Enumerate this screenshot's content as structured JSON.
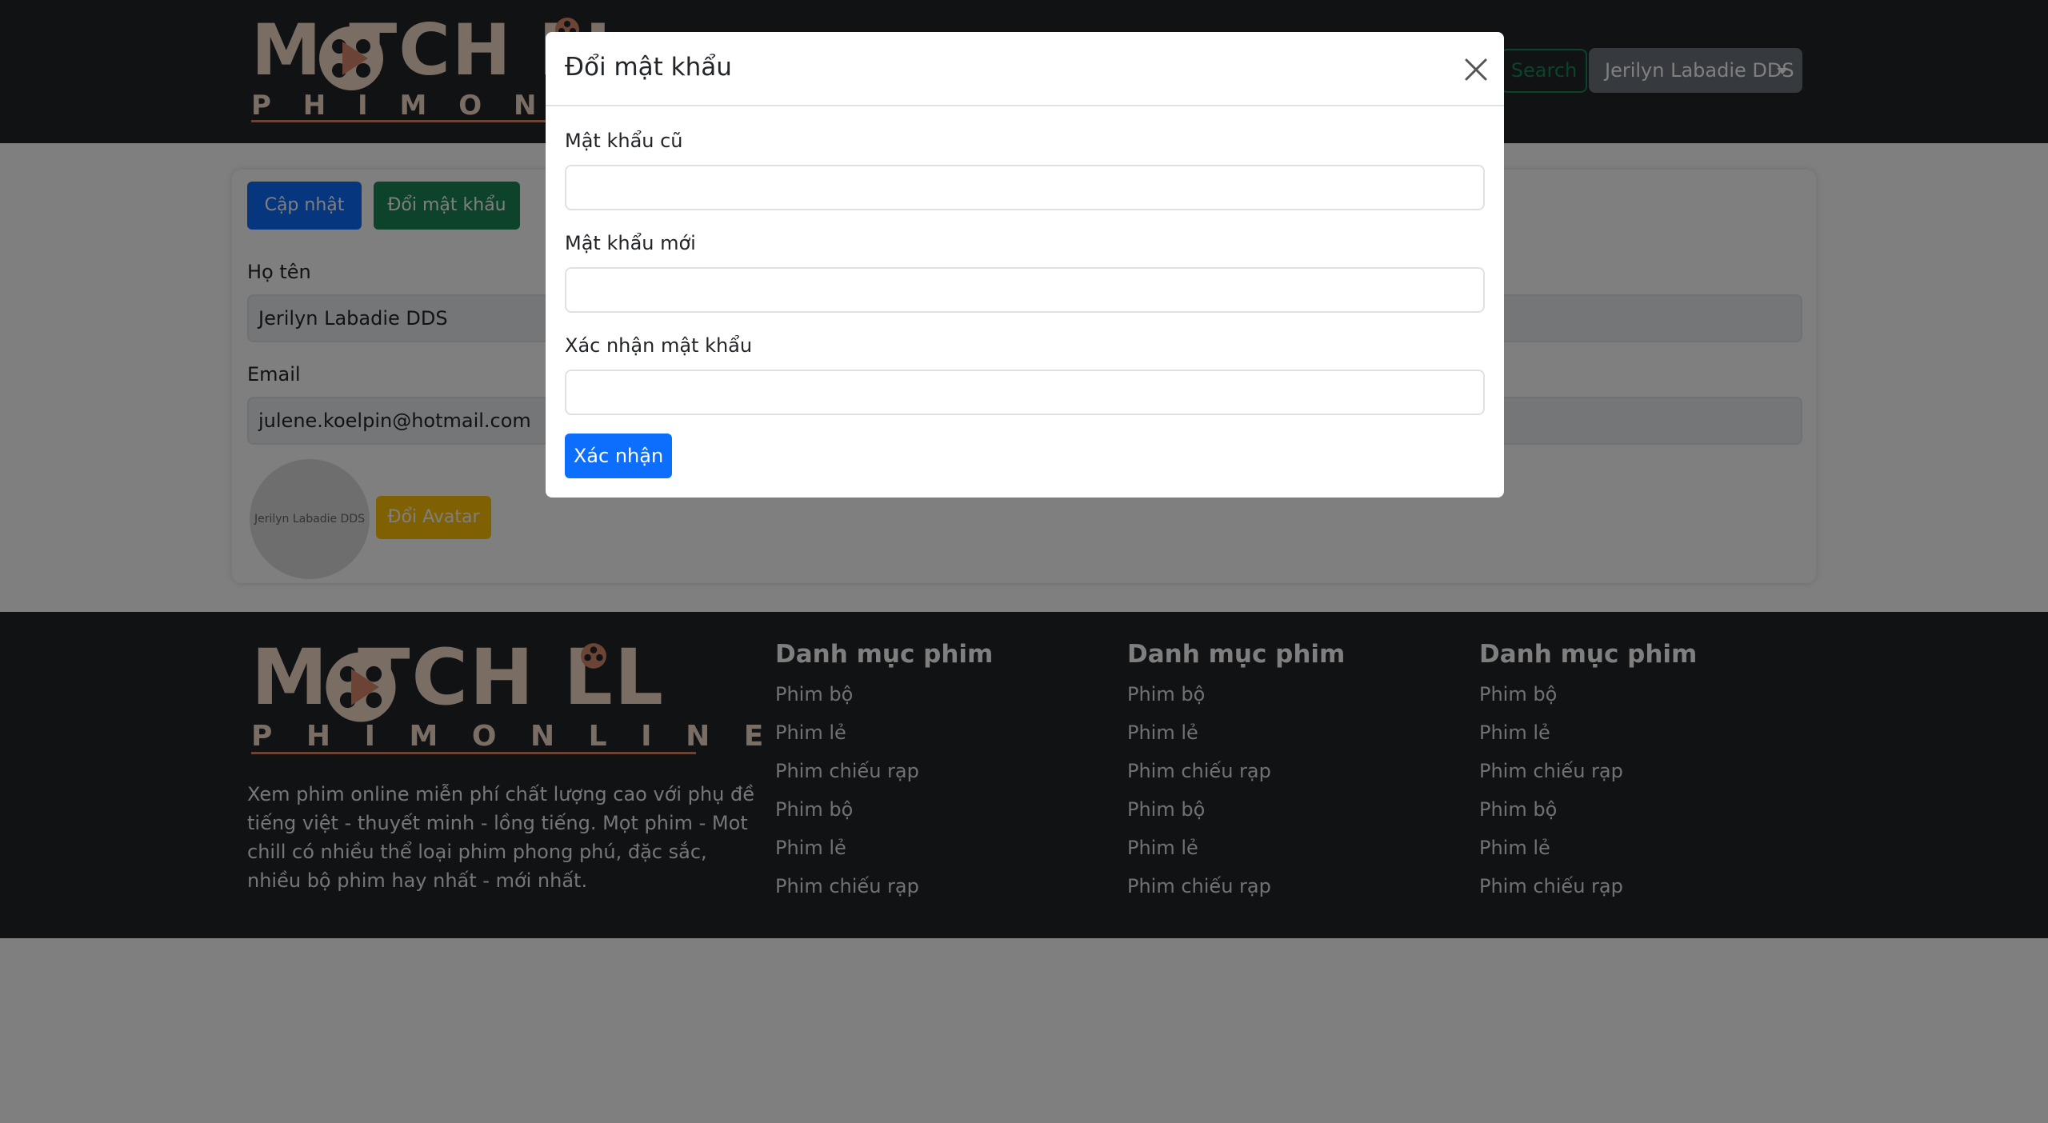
{
  "header": {
    "logo_top": "M  TCH LL",
    "logo_bottom": "P H I M   O N L I N E",
    "search_button": "Search",
    "user_menu": "Jerilyn Labadie DDS"
  },
  "profile": {
    "update_button": "Cập nhật",
    "change_password_button": "Đổi mật khẩu",
    "name_label": "Họ tên",
    "name_value": "Jerilyn Labadie DDS",
    "email_label": "Email",
    "email_value": "julene.koelpin@hotmail.com",
    "avatar_text": "Jerilyn Labadie DDS",
    "change_avatar_button": "Đổi Avatar"
  },
  "footer": {
    "logo_top": "M  TCH LL",
    "logo_bottom": "P H I M   O N L I N E",
    "description": "Xem phim online miễn phí chất lượng cao với phụ đề tiếng việt - thuyết minh - lồng tiếng. Mọt phim - Mot chill có nhiều thể loại phim phong phú, đặc sắc, nhiều bộ phim hay nhất - mới nhất.",
    "columns": [
      {
        "title": "Danh mục phim",
        "links": [
          "Phim bộ",
          "Phim lẻ",
          "Phim chiếu rạp",
          "Phim bộ",
          "Phim lẻ",
          "Phim chiếu rạp"
        ]
      },
      {
        "title": "Danh mục phim",
        "links": [
          "Phim bộ",
          "Phim lẻ",
          "Phim chiếu rạp",
          "Phim bộ",
          "Phim lẻ",
          "Phim chiếu rạp"
        ]
      },
      {
        "title": "Danh mục phim",
        "links": [
          "Phim bộ",
          "Phim lẻ",
          "Phim chiếu rạp",
          "Phim bộ",
          "Phim lẻ",
          "Phim chiếu rạp"
        ]
      }
    ]
  },
  "modal": {
    "title": "Đổi mật khẩu",
    "old_password_label": "Mật khẩu cũ",
    "old_password_value": "",
    "new_password_label": "Mật khẩu mới",
    "new_password_value": "",
    "confirm_password_label": "Xác nhận mật khẩu",
    "confirm_password_value": "",
    "submit_button": "Xác nhận",
    "close_icon": "close-icon"
  },
  "colors": {
    "navbar_bg": "#212529",
    "primary": "#0d6efd",
    "success": "#198754",
    "warning": "#ffc107",
    "secondary": "#6c757d",
    "logo_accent": "#d7886a"
  }
}
